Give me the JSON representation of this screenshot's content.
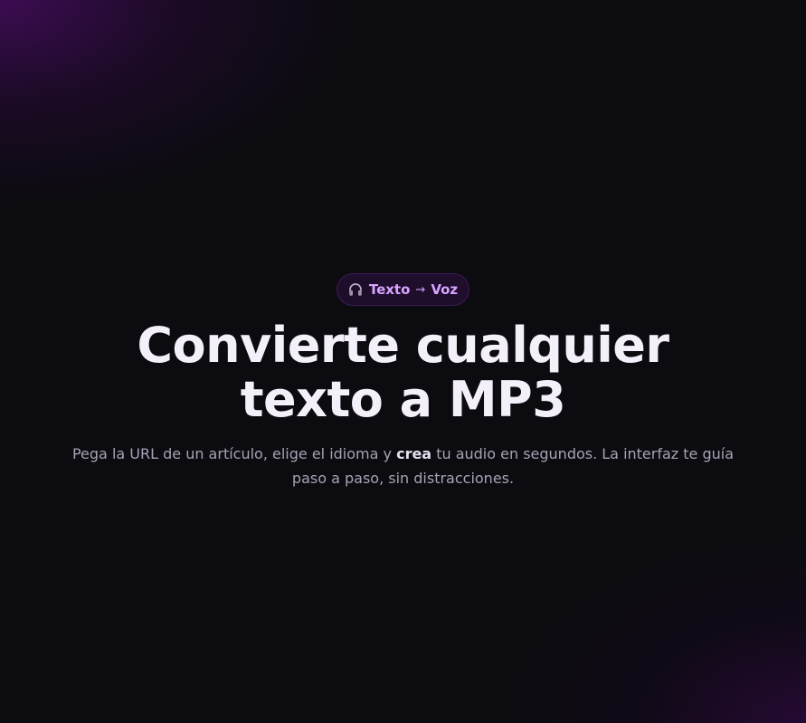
{
  "badge": {
    "icon": "headphones-icon",
    "from": "Texto",
    "arrow": "→",
    "to": "Voz",
    "color": "#d7a4ff"
  },
  "hero": {
    "title_line1": "Convierte cualquier",
    "title_line2": "texto a MP3",
    "subtitle_before": "Pega la URL de un artículo, elige el idioma y",
    "subtitle_emphasis": "crea",
    "subtitle_after": "tu audio en segundos. La interfaz te guía paso a paso, sin distracciones."
  },
  "colors": {
    "background": "#0c0b10",
    "accent_glow": "#4c0c68",
    "title": "#f4f0fa",
    "subtitle": "#a8a2b4"
  }
}
